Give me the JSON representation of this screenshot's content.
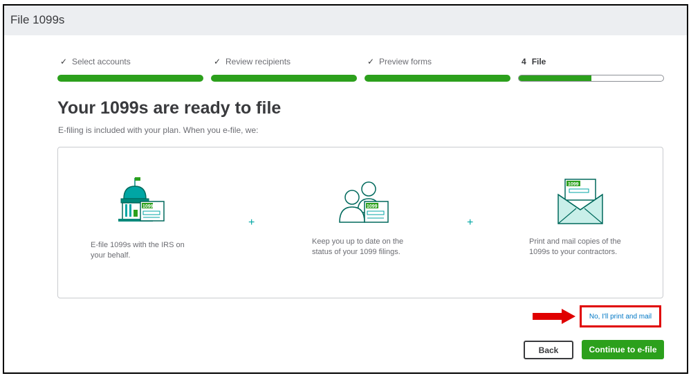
{
  "header": {
    "title": "File 1099s"
  },
  "stepper": {
    "steps": [
      {
        "marker": "✓",
        "label": "Select accounts",
        "progress": 1.0
      },
      {
        "marker": "✓",
        "label": "Review recipients",
        "progress": 1.0
      },
      {
        "marker": "✓",
        "label": "Preview forms",
        "progress": 1.0
      },
      {
        "marker": "4",
        "label": "File",
        "progress": 0.5
      }
    ]
  },
  "main": {
    "heading": "Your 1099s are ready to file",
    "subheading": "E-filing is included with your plan. When you e-file, we:",
    "features": [
      {
        "icon": "government-building-1099-icon",
        "form_label": "1099",
        "text_line1": "E-file 1099s with the IRS on",
        "text_line2": "your behalf."
      },
      {
        "icon": "people-1099-icon",
        "form_label": "1099",
        "text_line1": "Keep you up to date on the",
        "text_line2": "status of your 1099 filings."
      },
      {
        "icon": "envelope-1099-icon",
        "form_label": "1099",
        "text_line1": "Print and mail copies of the",
        "text_line2": "1099s to your contractors."
      }
    ],
    "plus_symbol": "+"
  },
  "actions": {
    "print_mail_link": "No, I'll print and mail",
    "back_label": "Back",
    "continue_label": "Continue to e-file"
  },
  "colors": {
    "accent_green": "#2ca01c",
    "teal": "#00a6a4",
    "annotation_red": "#e00000",
    "link_blue": "#0077c5"
  }
}
